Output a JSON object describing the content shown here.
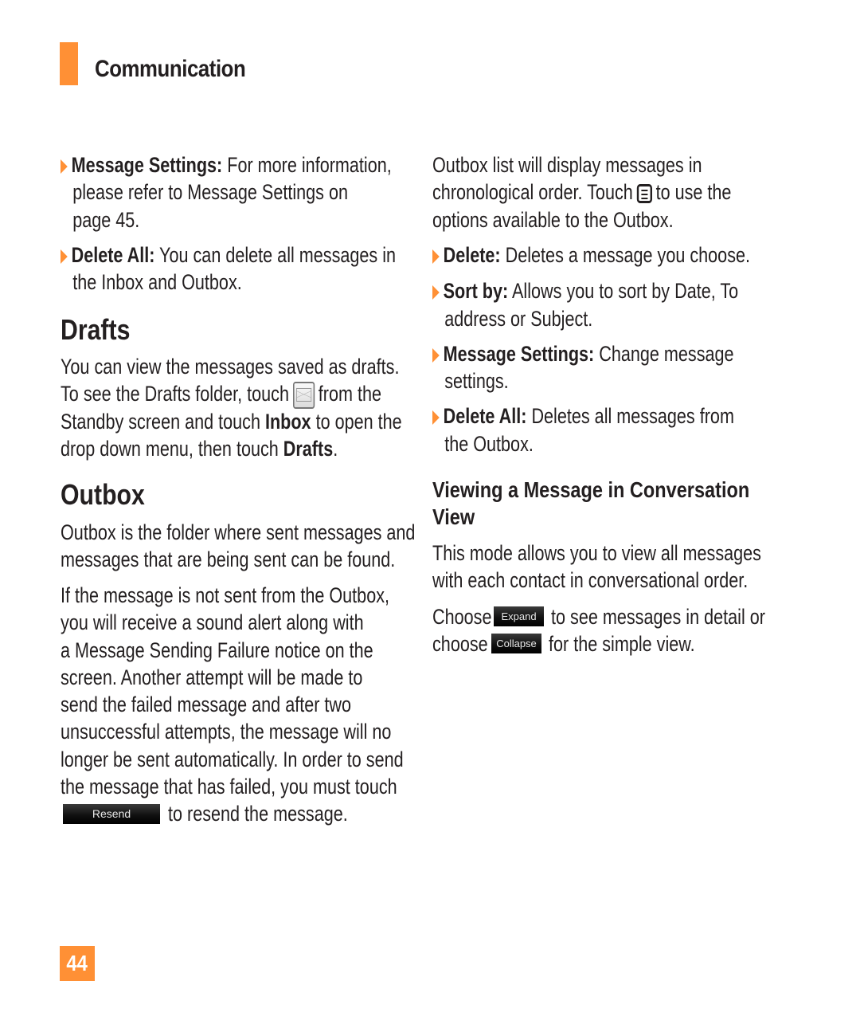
{
  "header": {
    "section_title": "Communication"
  },
  "left_column": {
    "bullets_top": [
      {
        "label": "Message Settings:",
        "lines": [
          " For more information,",
          "please refer to Message Settings on",
          "page 45."
        ]
      },
      {
        "label": "Delete All:",
        "lines": [
          " You can delete all messages in",
          "the Inbox and Outbox."
        ]
      }
    ],
    "drafts": {
      "heading": "Drafts",
      "line1": "You can view the messages saved as drafts.",
      "line2_before": "To see the Drafts folder, touch",
      "line2_after": "from the",
      "line3_before": "Standby screen and touch ",
      "line3_bold": "Inbox",
      "line3_after": " to open the",
      "line4_before": "drop down menu, then touch ",
      "line4_bold": "Drafts",
      "line4_after": ".",
      "icon": "envelope-icon"
    },
    "outbox": {
      "heading": "Outbox",
      "para1": [
        "Outbox is the folder where sent messages and",
        "messages that are being sent can be found."
      ],
      "para2": [
        "If the message is not sent from the Outbox,",
        "you will receive a sound alert along with",
        "a Message Sending Failure notice on the",
        "screen. Another attempt will be made to",
        "send the failed message and after two",
        "unsuccessful attempts, the message will no",
        "longer be sent automatically. In order to send",
        "the message that has failed, you must touch"
      ],
      "resend_button": "Resend",
      "resend_after": "to resend the message."
    }
  },
  "right_column": {
    "intro_line1": "Outbox list will display messages in",
    "intro_line2_before": "chronological order. Touch",
    "intro_line2_after": "to use the",
    "intro_line3": "options available to the Outbox.",
    "menu_icon": "menu-icon",
    "bullets": [
      {
        "label": "Delete:",
        "lines": [
          " Deletes a message you choose."
        ]
      },
      {
        "label": "Sort by:",
        "lines": [
          " Allows you to sort by Date, To",
          "address or Subject."
        ]
      },
      {
        "label": "Message Settings:",
        "lines": [
          " Change message",
          "settings."
        ]
      },
      {
        "label": "Delete All:",
        "lines": [
          " Deletes all messages from",
          "the Outbox."
        ]
      }
    ],
    "conversation": {
      "heading_line1": "Viewing a Message in Conversation",
      "heading_line2": "View",
      "para": [
        "This mode allows you to view all messages",
        "with each contact in conversational order."
      ],
      "choose1": "Choose",
      "expand_button": "Expand",
      "choose1_after": "to see messages in detail or",
      "choose2": "choose",
      "collapse_button": "Collapse",
      "choose2_after": "for the simple view."
    }
  },
  "footer": {
    "page_number": "44"
  },
  "colors": {
    "accent": "#ff9035",
    "text": "#231f20"
  }
}
